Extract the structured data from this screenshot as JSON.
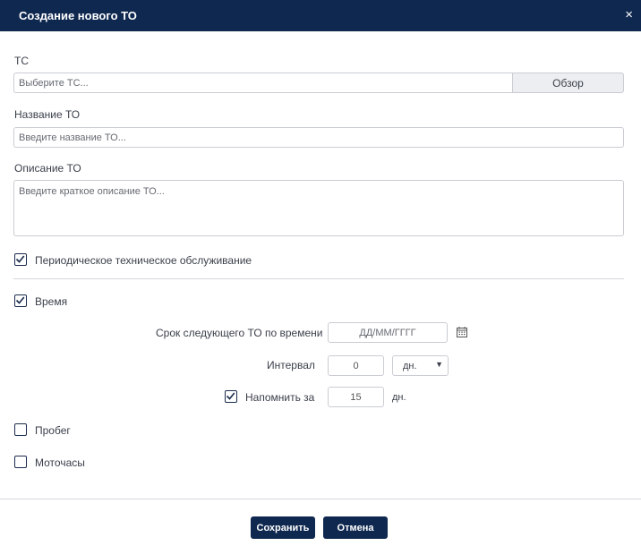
{
  "dialog": {
    "title": "Создание нового ТО",
    "close_symbol": "×"
  },
  "vehicle": {
    "label": "ТС",
    "placeholder": "Выберите ТС...",
    "browse_label": "Обзор"
  },
  "name": {
    "label": "Название ТО",
    "placeholder": "Введите название ТО..."
  },
  "description": {
    "label": "Описание ТО",
    "placeholder": "Введите краткое описание ТО..."
  },
  "periodic": {
    "label": "Периодическое техническое обслуживание",
    "checked": true
  },
  "time": {
    "label": "Время",
    "checked": true,
    "next_due_label": "Срок следующего ТО по времени",
    "date_placeholder": "ДД/ММ/ГГГГ",
    "interval_label": "Интервал",
    "interval_value": "0",
    "interval_unit": "дн.",
    "remind_label": "Напомнить за",
    "remind_checked": true,
    "remind_value": "15",
    "remind_unit": "дн."
  },
  "mileage": {
    "label": "Пробег",
    "checked": false
  },
  "engine_hours": {
    "label": "Моточасы",
    "checked": false
  },
  "footer": {
    "save_label": "Сохранить",
    "cancel_label": "Отмена"
  },
  "colors": {
    "header_bg": "#0f2850",
    "button_bg": "#0f2850",
    "text": "#3a3f4a",
    "border": "#c9ccd2"
  }
}
